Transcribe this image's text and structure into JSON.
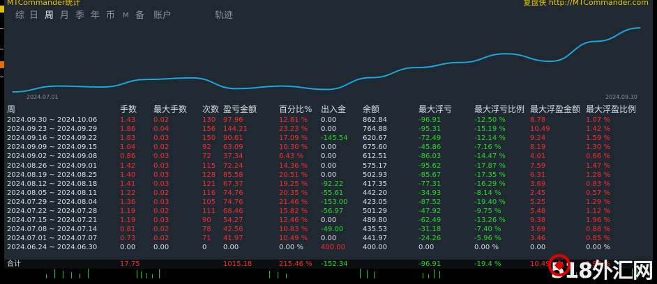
{
  "app": {
    "title_left": "MTCommander统计",
    "title_right": "复盘侠 http://MTCommander.com"
  },
  "tabs": [
    "综",
    "日",
    "周",
    "月",
    "季",
    "年",
    "币",
    "M",
    "备",
    "账户",
    "轨迹"
  ],
  "active_tab": "周",
  "chart_data": {
    "type": "line",
    "x_start_label": "2024.07.01",
    "x_end_label": "2024.09.30",
    "x": [
      "2024.06.24",
      "2024.07.01",
      "2024.07.08",
      "2024.07.15",
      "2024.07.22",
      "2024.07.29",
      "2024.08.05",
      "2024.08.12",
      "2024.08.19",
      "2024.08.26",
      "2024.09.02",
      "2024.09.09",
      "2024.09.16",
      "2024.09.23",
      "2024.09.30"
    ],
    "series": [
      {
        "values": [
          400.0,
          441.97,
          435.53,
          489.8,
          501.29,
          423.05,
          442.2,
          417.35,
          502.93,
          575.17,
          612.51,
          675.6,
          620.67,
          764.88,
          862.84
        ]
      }
    ],
    "line_color": "#1aa8e0"
  },
  "table": {
    "headers": [
      "周",
      "手数",
      "最大手数",
      "次数",
      "盈亏金额",
      "百分比%",
      "出入金",
      "余额",
      "最大浮亏",
      "最大浮亏比例",
      "最大浮盈金额",
      "最大浮盈比例"
    ],
    "rows": [
      [
        "2024.09.30 ~ 2024.10.06",
        "1.43",
        "0.02",
        "130",
        "97.96",
        "12.81 %",
        "0.00",
        "862.84",
        "-96.91",
        "-12.50 %",
        "8.78",
        "1.07 %"
      ],
      [
        "2024.09.23 ~ 2024.09.29",
        "1.86",
        "0.04",
        "156",
        "144.21",
        "23.23 %",
        "0.00",
        "764.88",
        "-95.31",
        "-15.19 %",
        "10.49",
        "1.42 %"
      ],
      [
        "2024.09.16 ~ 2024.09.22",
        "1.83",
        "0.03",
        "150",
        "90.61",
        "17.09 %",
        "-145.54",
        "620.67",
        "-72.49",
        "-12.14 %",
        "9.24",
        "1.59 %"
      ],
      [
        "2024.09.09 ~ 2024.09.15",
        "1.04",
        "0.02",
        "92",
        "63.09",
        "10.30 %",
        "0.00",
        "675.60",
        "-45.86",
        "-7.16 %",
        "8.19",
        "1.30 %"
      ],
      [
        "2024.09.02 ~ 2024.09.08",
        "0.86",
        "0.03",
        "72",
        "37.34",
        "6.43 %",
        "0.00",
        "612.51",
        "-86.03",
        "-14.47 %",
        "4.01",
        "0.66 %"
      ],
      [
        "2024.08.26 ~ 2024.09.01",
        "1.42",
        "0.03",
        "115",
        "72.24",
        "14.36 %",
        "0.00",
        "575.17",
        "-95.62",
        "-17.87 %",
        "7.59",
        "1.47 %"
      ],
      [
        "2024.08.19 ~ 2024.08.25",
        "1.40",
        "0.03",
        "128",
        "85.58",
        "20.51 %",
        "0.00",
        "502.93",
        "-85.67",
        "-17.35 %",
        "6.31",
        "1.28 %"
      ],
      [
        "2024.08.12 ~ 2024.08.18",
        "1.41",
        "0.03",
        "121",
        "67.37",
        "19.25 %",
        "-92.22",
        "417.35",
        "-77.31",
        "-16.29 %",
        "3.69",
        "0.83 %"
      ],
      [
        "2024.08.05 ~ 2024.08.11",
        "1.22",
        "0.02",
        "116",
        "74.76",
        "20.35 %",
        "-55.61",
        "442.20",
        "-34.93",
        "-8.14 %",
        "2.45",
        "0.57 %"
      ],
      [
        "2024.07.29 ~ 2024.08.04",
        "1.36",
        "0.03",
        "105",
        "74.76",
        "21.46 %",
        "-153.00",
        "423.05",
        "-87.52",
        "-19.40 %",
        "5.25",
        "1.29 %"
      ],
      [
        "2024.07.22 ~ 2024.07.28",
        "1.19",
        "0.02",
        "111",
        "68.46",
        "15.82 %",
        "-56.97",
        "501.29",
        "-47.92",
        "-9.75 %",
        "5.48",
        "1.12 %"
      ],
      [
        "2024.07.15 ~ 2024.07.21",
        "1.19",
        "0.03",
        "90",
        "54.27",
        "12.46 %",
        "0.00",
        "489.80",
        "-62.49",
        "-13.26 %",
        "9.38",
        "1.96 %"
      ],
      [
        "2024.07.08 ~ 2024.07.14",
        "0.81",
        "0.02",
        "78",
        "42.56",
        "10.83 %",
        "-49.00",
        "435.53",
        "-31.18",
        "-7.40 %",
        "3.69",
        "0.88 %"
      ],
      [
        "2024.07.01 ~ 2024.07.07",
        "0.73",
        "0.02",
        "71",
        "41.97",
        "10.49 %",
        "0.00",
        "441.97",
        "-24.26",
        "-5.96 %",
        "3.46",
        "0.85 %"
      ],
      [
        "2024.06.24 ~ 2024.06.30",
        "0.00",
        "0.00",
        "0",
        "0.00",
        "0.00 %",
        "400.00",
        "400.00",
        "0.00",
        "0.00 %",
        "0.00",
        "0.00 %"
      ]
    ],
    "total": [
      "合计",
      "17.75",
      "",
      "",
      "1015.18",
      "215.46 %",
      "-152.34",
      "",
      "-96.91",
      "-19.4 %",
      "10.49",
      "1.96 %"
    ]
  },
  "watermark": "518外汇网",
  "colors": {
    "profit": "#ff2a2a",
    "loss": "#22dd22",
    "neutral": "#d8dde2",
    "panel": "#202832",
    "title": "#e8c800"
  }
}
